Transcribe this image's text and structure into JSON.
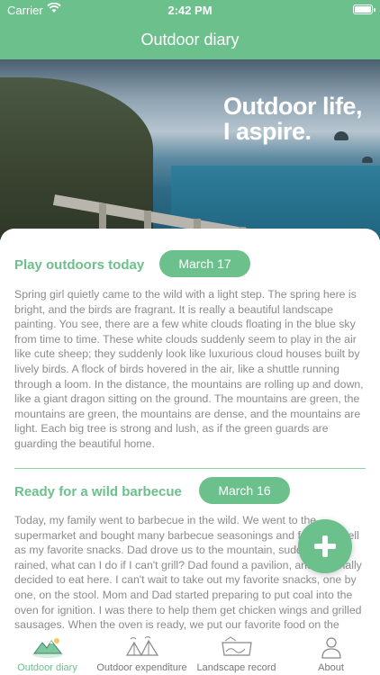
{
  "status": {
    "carrier": "Carrier",
    "time": "2:42 PM"
  },
  "nav": {
    "title": "Outdoor diary"
  },
  "hero": {
    "tagline_line1": "Outdoor life,",
    "tagline_line2": "I aspire."
  },
  "entries": [
    {
      "title": "Play outdoors today",
      "date": "March 17",
      "body": "Spring girl quietly came to the wild with a light step. The spring here is bright, and the birds are fragrant. It is really a beautiful landscape painting. You see, there are a few white clouds floating in the blue sky from time to time. These white clouds suddenly seem to play in the air like cute sheep; they suddenly look like luxurious cloud houses built by lively birds. A flock of birds hovered in the air, like a shuttle running through a loom. In the distance, the mountains are rolling up and down, like a giant dragon sitting on the ground. The mountains are green, the mountains are green, the mountains are dense, and the mountains are light. Each big tree is strong and lush, as if the green guards are guarding the beautiful home."
    },
    {
      "title": "Ready for a wild barbecue",
      "date": "March 16",
      "body": "Today, my family went to barbecue in the wild. We went to the supermarket and bought many barbecue seasonings and food, as well as my favorite snacks. Dad drove us to the mountain, suddenly it rained, what can I do if I can't grill? Dad found a pavilion, and we finally decided to eat here. I can't wait to take out my favorite snacks, one by one, on the stool. Mom and Dad started preparing to put coal into the oven for ignition. I was there to help them get chicken wings and grilled sausages. When the oven is ready, we put our favorite food on the stove for ten minutes, and"
    }
  ],
  "tabs": [
    {
      "label": "Outdoor diary",
      "icon": "mountain-icon",
      "active": true
    },
    {
      "label": "Outdoor expenditure",
      "icon": "tents-icon",
      "active": false
    },
    {
      "label": "Landscape record",
      "icon": "map-icon",
      "active": false
    },
    {
      "label": "About",
      "icon": "person-icon",
      "active": false
    }
  ],
  "colors": {
    "accent": "#6cc08c",
    "body_text": "#8b8b8b",
    "divider": "#8fd1a9"
  }
}
